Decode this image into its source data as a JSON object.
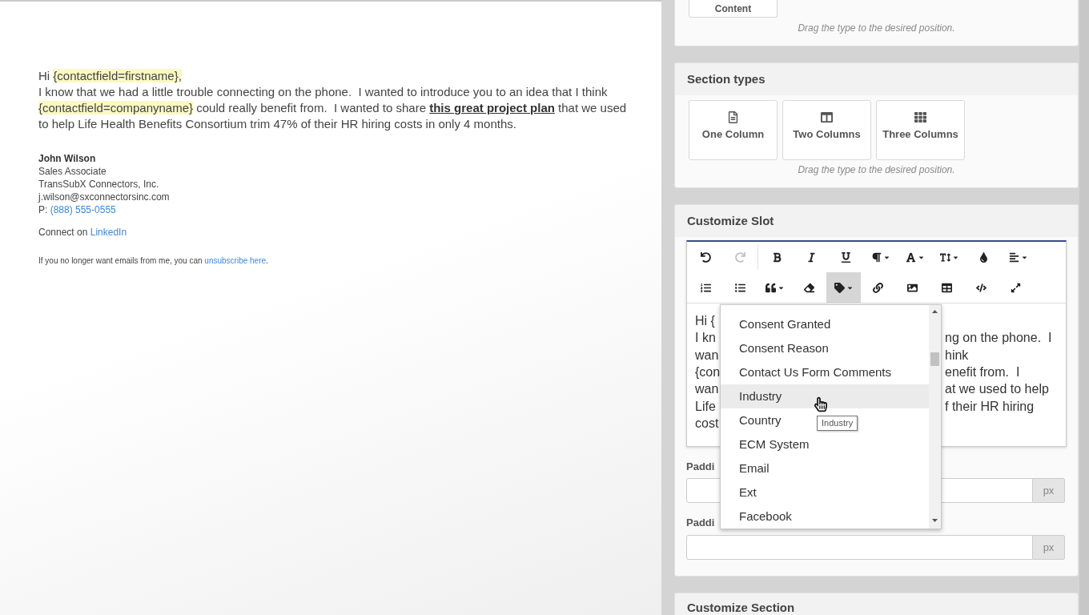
{
  "email": {
    "greeting": [
      {
        "kind": "text",
        "text": "Hi "
      },
      {
        "kind": "merge_field",
        "text": "{contactfield=firstname},"
      }
    ],
    "body": [
      {
        "kind": "text",
        "text": "I know that we had a little trouble connecting on the phone.  I wanted to introduce you to an idea that I think "
      },
      {
        "kind": "merge_field",
        "text": "{contactfield=companyname}"
      },
      {
        "kind": "text",
        "text": " could really benefit from.  I wanted to share "
      },
      {
        "kind": "link",
        "text": "this great project plan"
      },
      {
        "kind": "text",
        "text": " that we used to help Life Health Benefits Consortium trim 47% of their HR hiring costs in only 4 months."
      }
    ],
    "signature": {
      "name": "John Wilson",
      "title": "Sales Associate",
      "company": "TransSubX Connectors, Inc.",
      "email": "j.wilson@sxconnectorsinc.com",
      "phone_label": "P: ",
      "phone": "(888) 555-0555"
    },
    "social": {
      "text": "Connect on ",
      "link": "LinkedIn"
    },
    "footer": {
      "text": "If you no longer want emails from me, you can ",
      "link": "unsubscribe here",
      "end": "."
    }
  },
  "content_types": {
    "items": [
      "Content"
    ],
    "hint": "Drag the type to the desired position."
  },
  "section_types": {
    "title": "Section types",
    "items": [
      "One Column",
      "Two Columns",
      "Three Columns"
    ],
    "hint": "Drag the type to the desired position."
  },
  "customize_slot": {
    "title": "Customize Slot",
    "toolbar": [
      [
        {
          "active": false,
          "disabled": false
        },
        {
          "active": false,
          "disabled": true
        },
        {
          "active": false,
          "disabled": false
        },
        {
          "active": false,
          "disabled": false
        },
        {
          "active": false,
          "disabled": false
        },
        {
          "active": false,
          "disabled": false
        },
        {
          "active": false,
          "disabled": false
        },
        {
          "active": false,
          "disabled": false
        },
        {
          "active": false,
          "disabled": false
        },
        {
          "active": false,
          "disabled": false
        }
      ],
      [
        {
          "active": false,
          "disabled": false
        },
        {
          "active": false,
          "disabled": false
        },
        {
          "active": false,
          "disabled": false
        },
        {
          "active": false,
          "disabled": false
        },
        {
          "active": true,
          "disabled": false
        },
        {
          "active": false,
          "disabled": false
        },
        {
          "active": false,
          "disabled": false
        },
        {
          "active": false,
          "disabled": false
        },
        {
          "active": false,
          "disabled": false
        },
        {
          "active": false,
          "disabled": false
        }
      ]
    ],
    "editor_lines": [
      {
        "left": "Hi {"
      },
      {
        "left": "I kn",
        "right": "ng on the phone.  I"
      },
      {
        "left": "wan",
        "right": "hink"
      },
      {
        "left": "{con",
        "right": "enefit from.  I"
      },
      {
        "left": "wan",
        "right": "at we used to help"
      },
      {
        "left": "Life",
        "right": "f their HR hiring"
      },
      {
        "left": "cost"
      }
    ],
    "field_menu": {
      "items": [
        {
          "label": "Consent Granted",
          "selected": false
        },
        {
          "label": "Consent Reason",
          "selected": false
        },
        {
          "label": "Contact Us Form Comments",
          "selected": false
        },
        {
          "label": "Industry",
          "selected": true
        },
        {
          "label": "Country",
          "selected": false
        },
        {
          "label": "ECM System",
          "selected": false
        },
        {
          "label": "Email",
          "selected": false
        },
        {
          "label": "Ext",
          "selected": false
        },
        {
          "label": "Facebook",
          "selected": false
        }
      ],
      "tooltip": "Industry"
    },
    "fields": [
      {
        "label": "Paddi",
        "unit": "px"
      },
      {
        "label": "Paddi",
        "unit": "px"
      }
    ]
  },
  "customize_section": {
    "title": "Customize Section"
  }
}
